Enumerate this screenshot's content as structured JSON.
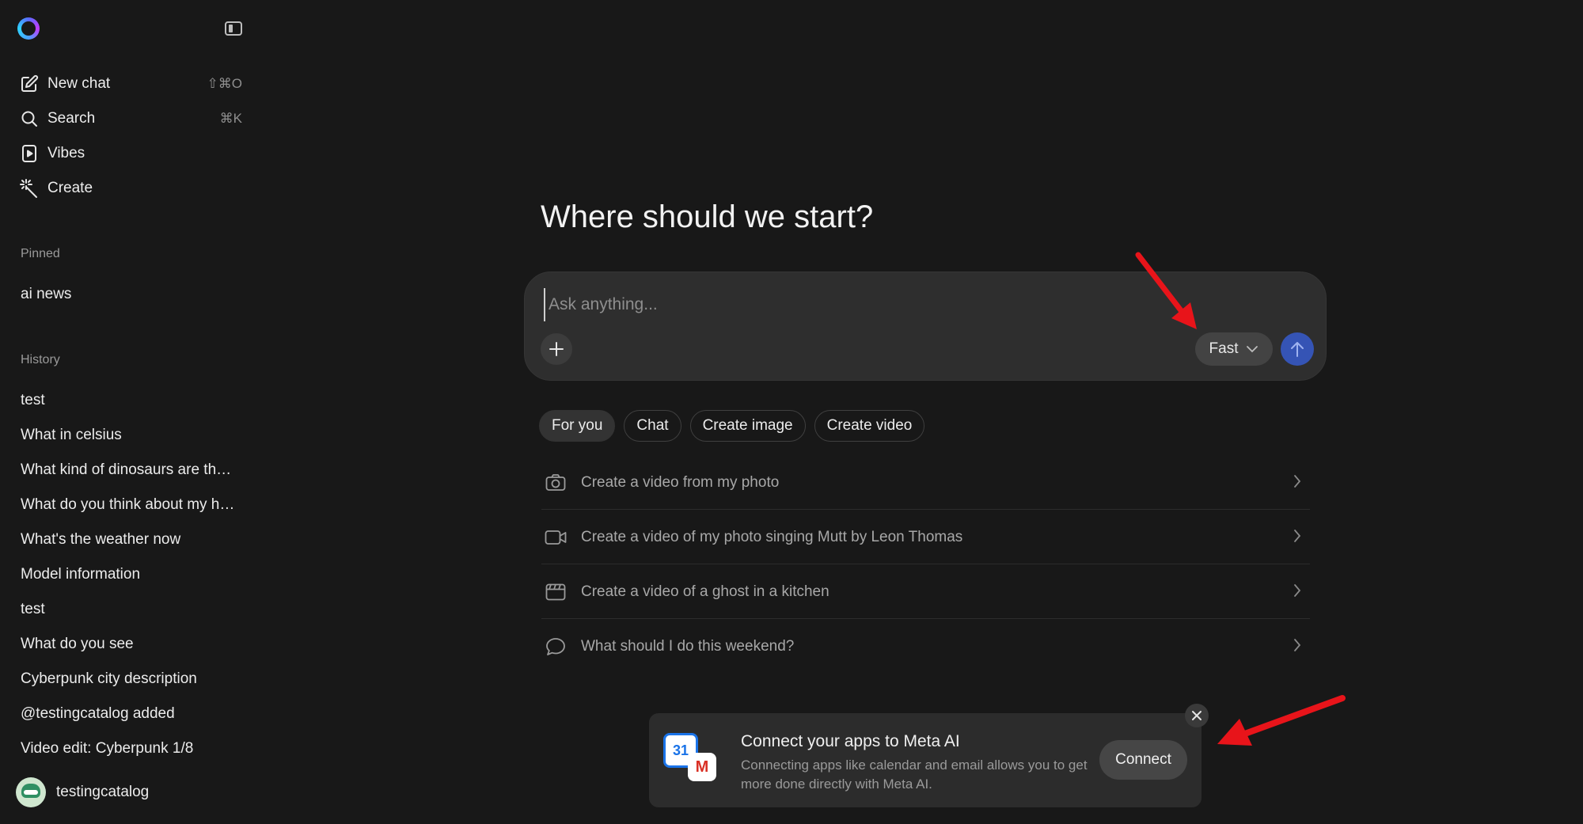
{
  "sidebar": {
    "nav": [
      {
        "label": "New chat",
        "shortcut": "⇧⌘O",
        "icon": "compose-icon"
      },
      {
        "label": "Search",
        "shortcut": "⌘K",
        "icon": "search-icon"
      },
      {
        "label": "Vibes",
        "shortcut": "",
        "icon": "vibes-icon"
      },
      {
        "label": "Create",
        "shortcut": "",
        "icon": "sparkle-wand-icon"
      }
    ],
    "pinned_label": "Pinned",
    "pinned": [
      "ai news"
    ],
    "history_label": "History",
    "history": [
      "test",
      "What in celsius",
      "What kind of dinosaurs are th…",
      "What do you think about my h…",
      "What's the weather now",
      "Model information",
      "test",
      "What do you see",
      "Cyberpunk city description",
      "@testingcatalog added",
      "Video edit: Cyberpunk 1/8"
    ],
    "user": {
      "name": "testingcatalog"
    }
  },
  "main": {
    "heading": "Where should we start?",
    "composer": {
      "placeholder": "Ask anything...",
      "mode_label": "Fast"
    },
    "chips": [
      "For you",
      "Chat",
      "Create image",
      "Create video"
    ],
    "suggestions": [
      {
        "text": "Create a video from my photo",
        "icon": "camera-icon"
      },
      {
        "text": "Create a video of my photo singing Mutt by Leon Thomas",
        "icon": "video-camera-icon"
      },
      {
        "text": "Create a video of a ghost in a kitchen",
        "icon": "clapperboard-icon"
      },
      {
        "text": "What should I do this weekend?",
        "icon": "chat-bubble-icon"
      }
    ]
  },
  "banner": {
    "title": "Connect your apps to Meta AI",
    "text": "Connecting apps like calendar and email allows you to get more done directly with Meta AI.",
    "button": "Connect",
    "calendar_day": "31",
    "gmail_letter": "M"
  },
  "colors": {
    "background": "#181818",
    "accent_send": "#3554b5",
    "annotation_arrow": "#e8141a"
  }
}
